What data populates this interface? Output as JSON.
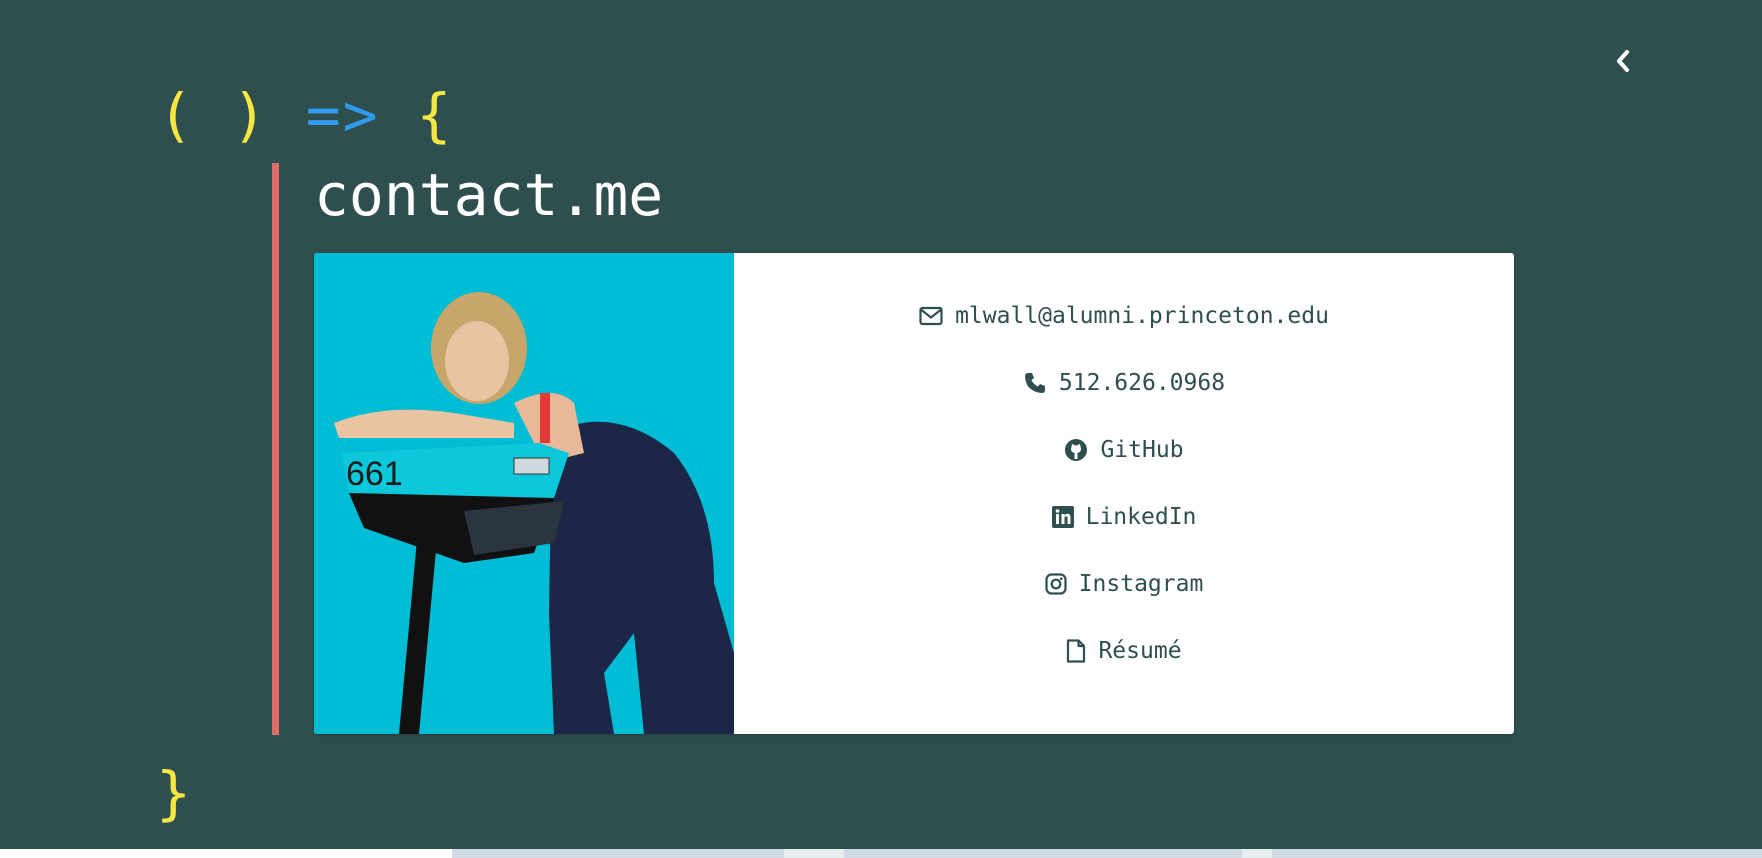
{
  "nav": {
    "back_icon": "chevron-left-icon"
  },
  "code": {
    "open_paren": "(",
    "close_paren": ")",
    "arrow": "=>",
    "open_brace": "{",
    "close_brace": "}"
  },
  "colors": {
    "background": "#2f4f4f",
    "paren": "#f5e642",
    "arrow": "#2e9bef",
    "accent_rule": "#e06b6b",
    "photo_bg": "#00bcd4",
    "link_text": "#2f4f4f"
  },
  "section": {
    "title": "contact.me"
  },
  "contact": {
    "photo_number": "661",
    "links": [
      {
        "icon": "envelope-icon",
        "label": "mlwall@alumni.princeton.edu"
      },
      {
        "icon": "phone-icon",
        "label": "512.626.0968"
      },
      {
        "icon": "github-icon",
        "label": "GitHub"
      },
      {
        "icon": "linkedin-icon",
        "label": "LinkedIn"
      },
      {
        "icon": "instagram-icon",
        "label": "Instagram"
      },
      {
        "icon": "file-icon",
        "label": "Résumé"
      }
    ]
  }
}
